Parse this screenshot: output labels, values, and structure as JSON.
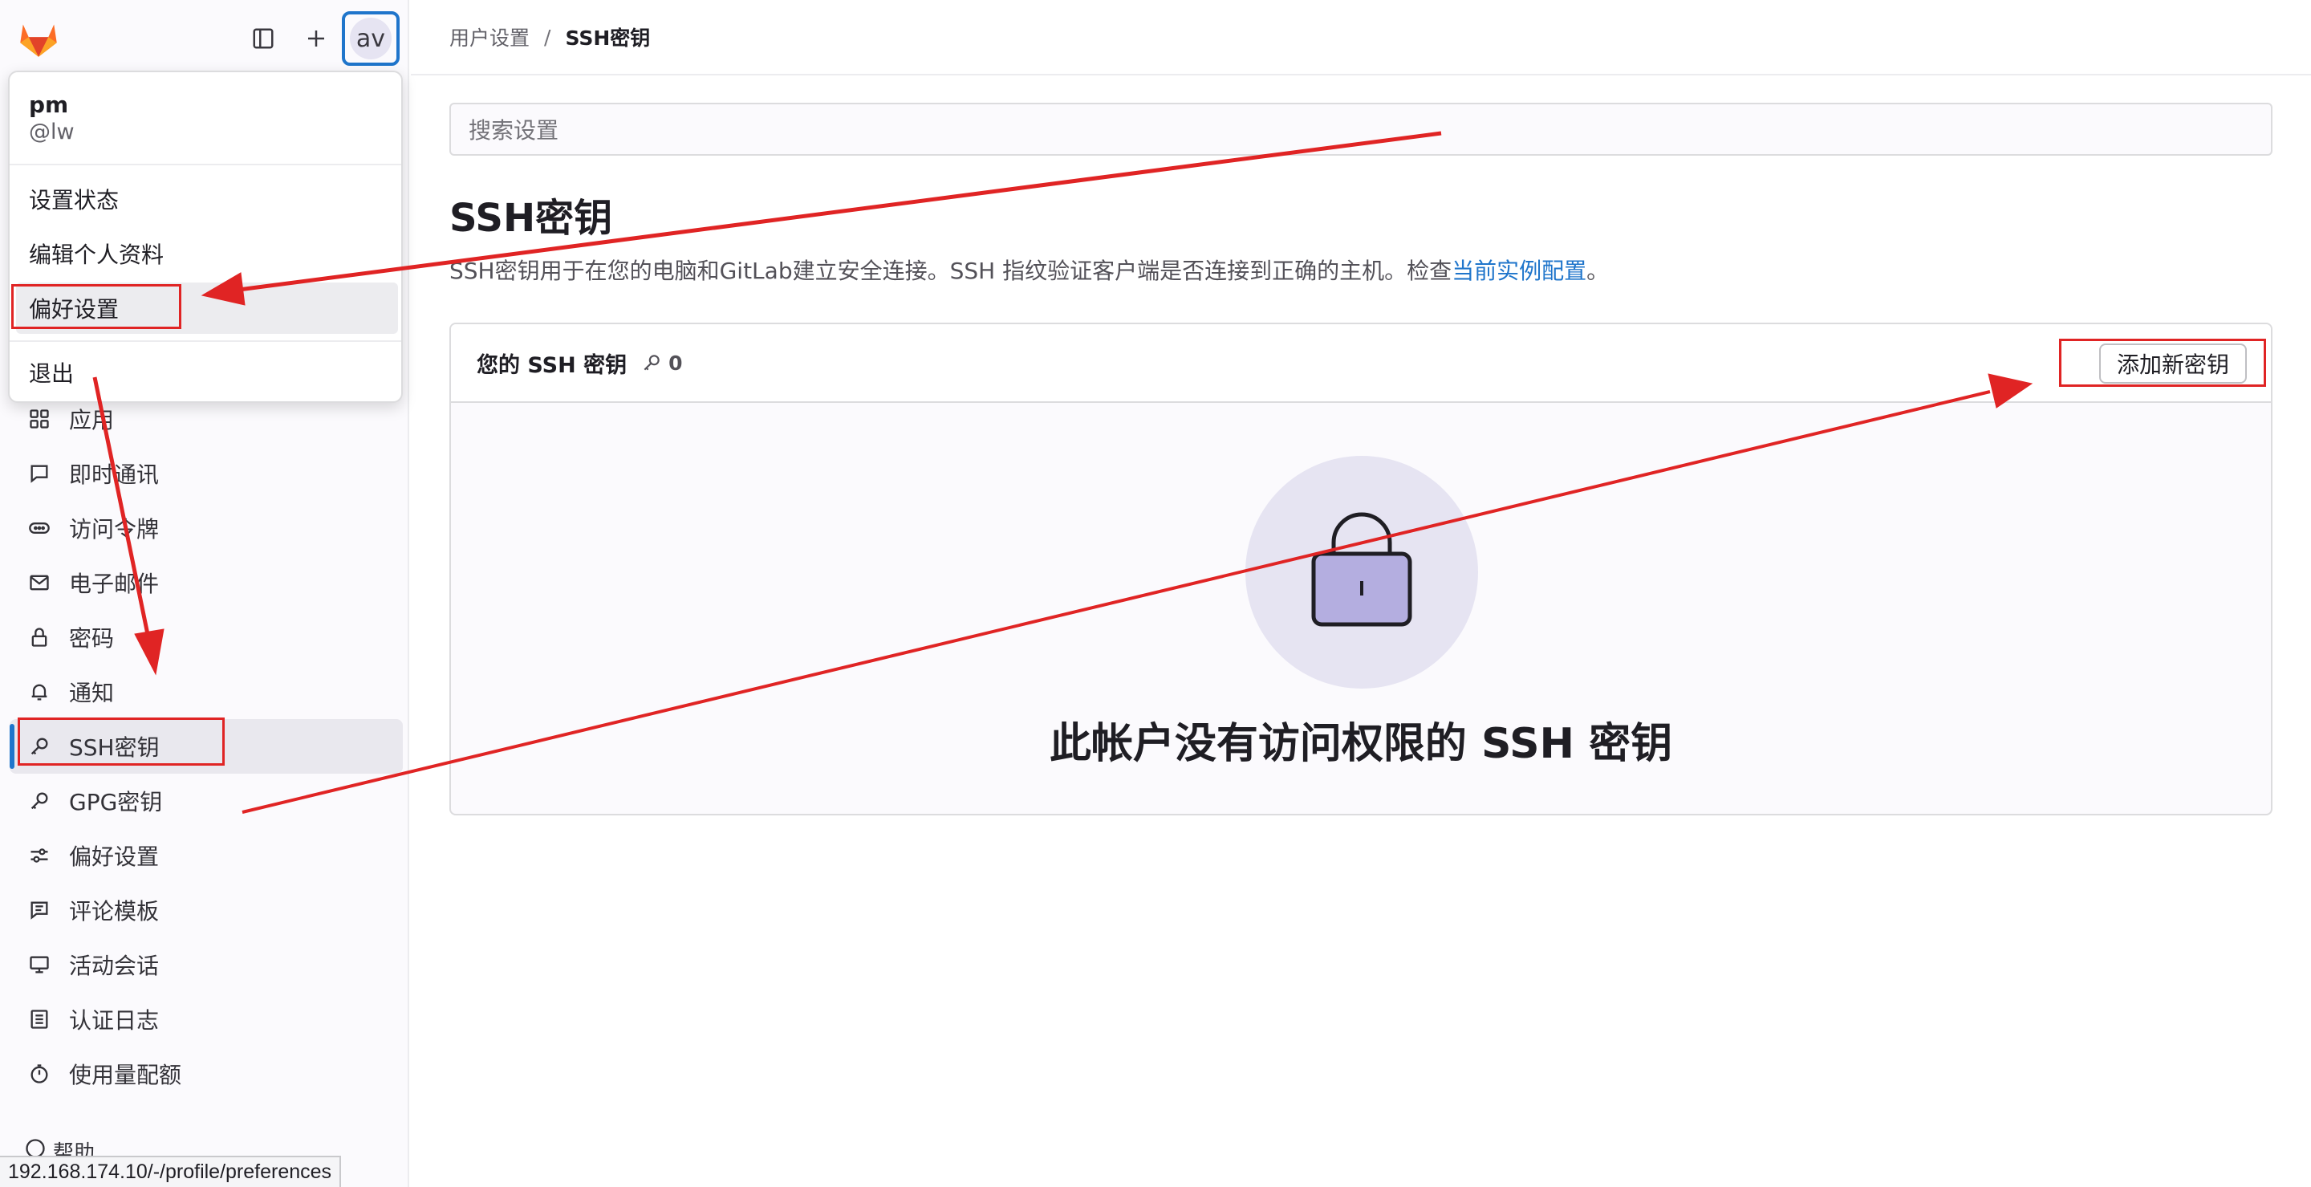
{
  "topbar": {
    "logo_icon": "gitlab-tanuki-icon",
    "sidebar_toggle_icon": "sidebar-toggle-icon",
    "new_icon": "plus-icon",
    "avatar_initials": "av"
  },
  "user_menu": {
    "name": "pm",
    "handle": "@lw",
    "items": [
      {
        "label": "设置状态"
      },
      {
        "label": "编辑个人资料"
      },
      {
        "label": "偏好设置"
      },
      {
        "label": "退出"
      }
    ]
  },
  "sidebar": {
    "items": [
      {
        "label": "应用",
        "icon": "applications-icon"
      },
      {
        "label": "即时通讯",
        "icon": "comment-icon"
      },
      {
        "label": "访问令牌",
        "icon": "token-icon"
      },
      {
        "label": "电子邮件",
        "icon": "mail-icon"
      },
      {
        "label": "密码",
        "icon": "lock-icon"
      },
      {
        "label": "通知",
        "icon": "bell-icon"
      },
      {
        "label": "SSH密钥",
        "icon": "key-icon"
      },
      {
        "label": "GPG密钥",
        "icon": "key-icon"
      },
      {
        "label": "偏好设置",
        "icon": "preferences-icon"
      },
      {
        "label": "评论模板",
        "icon": "comment-lines-icon"
      },
      {
        "label": "活动会话",
        "icon": "monitor-icon"
      },
      {
        "label": "认证日志",
        "icon": "log-icon"
      },
      {
        "label": "使用量配额",
        "icon": "quota-icon"
      }
    ],
    "help_label": "帮助"
  },
  "breadcrumb": {
    "parent": "用户设置",
    "separator": "/",
    "current": "SSH密钥"
  },
  "search": {
    "placeholder": "搜索设置"
  },
  "page": {
    "title": "SSH密钥",
    "description": "SSH密钥用于在您的电脑和GitLab建立安全连接。SSH 指纹验证客户端是否连接到正确的主机。检查",
    "description_link": "当前实例配置",
    "description_end": "。"
  },
  "ssh_card": {
    "title": "您的 SSH 密钥",
    "count": "0",
    "add_button": "添加新密钥",
    "empty_title": "此帐户没有访问权限的 SSH 密钥",
    "empty_icon": "padlock-icon"
  },
  "status_url": "192.168.174.10/-/profile/preferences",
  "colors": {
    "accent": "#1f75cb",
    "annotation": "#e02424",
    "illustration_bg": "#e6e4f2",
    "illustration_lock": "#b4aee0"
  }
}
